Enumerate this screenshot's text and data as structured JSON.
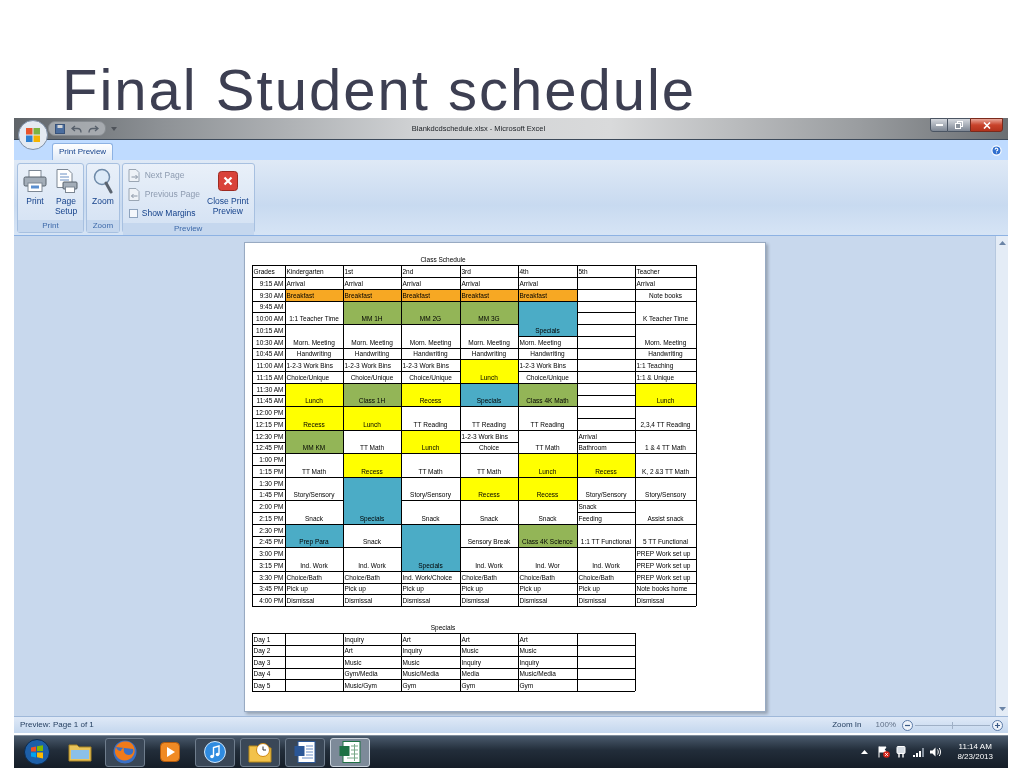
{
  "slide": {
    "title": "Final Student schedule"
  },
  "window": {
    "title": "Blankdcdschedule.xlsx - Microsoft Excel"
  },
  "tabs": [
    {
      "label": "Print Preview",
      "selected": true
    }
  ],
  "ribbon": {
    "groups": [
      {
        "label": "Print",
        "commands": [
          {
            "kind": "large",
            "lines": [
              "Print"
            ],
            "disabled": false
          },
          {
            "kind": "large",
            "lines": [
              "Page",
              "Setup"
            ],
            "disabled": false
          }
        ]
      },
      {
        "label": "Zoom",
        "commands": [
          {
            "kind": "large",
            "lines": [
              "Zoom"
            ],
            "disabled": false
          }
        ]
      },
      {
        "label": "Preview",
        "commands": [
          {
            "kind": "small",
            "lines": [
              "Next Page"
            ],
            "disabled": true
          },
          {
            "kind": "small",
            "lines": [
              "Previous Page"
            ],
            "disabled": true
          },
          {
            "kind": "checkbox",
            "lines": [
              "Show Margins"
            ],
            "checked": false,
            "disabled": false
          },
          {
            "kind": "large",
            "lines": [
              "Close Print",
              "Preview"
            ],
            "disabled": false
          }
        ]
      }
    ]
  },
  "sheet": {
    "schedule": {
      "title": "Class Schedule",
      "columns": [
        "Grades",
        "Kindergarten",
        "1st",
        "2nd",
        "3rd",
        "4th",
        "5th",
        "Teacher"
      ],
      "rows": [
        {
          "cells": [
            {
              "kind": "time",
              "text": "9:15 AM"
            },
            {
              "kind": "left",
              "text": "Arrival"
            },
            {
              "kind": "left",
              "text": "Arrival"
            },
            {
              "kind": "left",
              "text": "Arrival"
            },
            {
              "kind": "left",
              "text": "Arrival"
            },
            {
              "kind": "left",
              "text": "Arrival"
            },
            {
              "kind": "left"
            },
            {
              "kind": "left",
              "text": "Arrival"
            }
          ]
        },
        {
          "cells": [
            {
              "kind": "time",
              "text": "9:30 AM"
            },
            {
              "kind": "left",
              "text": "Breakfast",
              "color": "#f7a823"
            },
            {
              "kind": "left",
              "text": "Breakfast",
              "color": "#f7a823"
            },
            {
              "kind": "left",
              "text": "Breakfast",
              "color": "#f7a823"
            },
            {
              "kind": "left",
              "text": "Breakfast",
              "color": "#f7a823"
            },
            {
              "kind": "left",
              "text": "Breakfast",
              "color": "#f7a823"
            },
            {
              "kind": "left"
            },
            {
              "kind": "centered",
              "text": "Note books"
            }
          ]
        },
        {
          "cells": [
            {
              "kind": "time",
              "text": "9:45 AM"
            },
            {
              "kind": "merged"
            },
            {
              "kind": "merged"
            },
            {
              "kind": "merged"
            },
            {
              "kind": "merged"
            },
            {
              "kind": "merged"
            },
            {
              "kind": "left"
            },
            {
              "kind": "merged"
            }
          ]
        },
        {
          "cells": [
            {
              "kind": "time",
              "text": "10:00 AM"
            },
            {
              "kind": "centered",
              "text": "1:1 Teacher Time"
            },
            {
              "kind": "centered",
              "text": "MM 1H",
              "color": "#93b557"
            },
            {
              "kind": "centered",
              "text": "MM 2G",
              "color": "#93b557"
            },
            {
              "kind": "centered",
              "text": "MM 3G",
              "color": "#93b557"
            },
            {
              "kind": "merged"
            },
            {
              "kind": "left"
            },
            {
              "kind": "centered",
              "text": "K Teacher Time"
            }
          ]
        },
        {
          "cells": [
            {
              "kind": "time",
              "text": "10:15 AM"
            },
            {
              "kind": "merged"
            },
            {
              "kind": "merged"
            },
            {
              "kind": "merged"
            },
            {
              "kind": "merged"
            },
            {
              "kind": "centered",
              "text": "Specials",
              "color": "#4bacc6"
            },
            {
              "kind": "left"
            },
            {
              "kind": "merged"
            }
          ]
        },
        {
          "cells": [
            {
              "kind": "time",
              "text": "10:30 AM"
            },
            {
              "kind": "centered",
              "text": "Morn. Meeting"
            },
            {
              "kind": "centered",
              "text": "Morn. Meeting"
            },
            {
              "kind": "centered",
              "text": "Morn. Meeting"
            },
            {
              "kind": "centered",
              "text": "Morn. Meeting"
            },
            {
              "kind": "left",
              "text": "Morn. Meeting"
            },
            {
              "kind": "left"
            },
            {
              "kind": "centered",
              "text": "Morn. Meeting"
            }
          ]
        },
        {
          "cells": [
            {
              "kind": "time",
              "text": "10:45 AM"
            },
            {
              "kind": "centered",
              "text": "Handwriting"
            },
            {
              "kind": "centered",
              "text": "Handwriting"
            },
            {
              "kind": "centered",
              "text": "Handwriting"
            },
            {
              "kind": "centered",
              "text": "Handwriting"
            },
            {
              "kind": "centered",
              "text": "Handwriting"
            },
            {
              "kind": "left"
            },
            {
              "kind": "centered",
              "text": "Handwriting"
            }
          ]
        },
        {
          "cells": [
            {
              "kind": "time",
              "text": "11:00 AM"
            },
            {
              "kind": "left",
              "text": "1-2-3 Work Bins"
            },
            {
              "kind": "left",
              "text": "1-2-3 Work Bins"
            },
            {
              "kind": "left",
              "text": "1-2-3 Work Bins"
            },
            {
              "kind": "merged"
            },
            {
              "kind": "left",
              "text": "1-2-3 Work Bins"
            },
            {
              "kind": "left"
            },
            {
              "kind": "left",
              "text": "1:1 Teaching"
            }
          ]
        },
        {
          "cells": [
            {
              "kind": "time",
              "text": "11:15 AM"
            },
            {
              "kind": "left",
              "text": "Choice/Unique"
            },
            {
              "kind": "centered",
              "text": "Choice/Unique"
            },
            {
              "kind": "centered",
              "text": "Choice/Unique"
            },
            {
              "kind": "centered",
              "text": "Lunch",
              "color": "#ffff00"
            },
            {
              "kind": "centered",
              "text": "Choice/Unique"
            },
            {
              "kind": "left"
            },
            {
              "kind": "left",
              "text": "1:1 & Unique"
            }
          ]
        },
        {
          "cells": [
            {
              "kind": "time",
              "text": "11:30 AM"
            },
            {
              "kind": "merged"
            },
            {
              "kind": "merged"
            },
            {
              "kind": "merged"
            },
            {
              "kind": "merged"
            },
            {
              "kind": "merged"
            },
            {
              "kind": "left"
            },
            {
              "kind": "merged"
            }
          ]
        },
        {
          "cells": [
            {
              "kind": "time",
              "text": "11:45 AM"
            },
            {
              "kind": "centered",
              "text": "Lunch",
              "color": "#ffff00"
            },
            {
              "kind": "centered",
              "text": "Class 1H",
              "color": "#93b557"
            },
            {
              "kind": "centered",
              "text": "Recess",
              "color": "#ffff00"
            },
            {
              "kind": "centered",
              "text": "Specials",
              "color": "#4bacc6"
            },
            {
              "kind": "centered",
              "text": "Class 4K Math",
              "color": "#93b557"
            },
            {
              "kind": "left"
            },
            {
              "kind": "centered",
              "text": "Lunch",
              "color": "#ffff00"
            }
          ]
        },
        {
          "cells": [
            {
              "kind": "time",
              "text": "12:00 PM"
            },
            {
              "kind": "merged"
            },
            {
              "kind": "merged"
            },
            {
              "kind": "merged"
            },
            {
              "kind": "merged"
            },
            {
              "kind": "merged"
            },
            {
              "kind": "left"
            },
            {
              "kind": "merged"
            }
          ]
        },
        {
          "cells": [
            {
              "kind": "time",
              "text": "12:15 PM"
            },
            {
              "kind": "centered",
              "text": "Recess",
              "color": "#ffff00"
            },
            {
              "kind": "centered",
              "text": "Lunch",
              "color": "#ffff00"
            },
            {
              "kind": "centered",
              "text": "TT Reading"
            },
            {
              "kind": "centered",
              "text": "TT Reading"
            },
            {
              "kind": "centered",
              "text": "TT Reading"
            },
            {
              "kind": "left"
            },
            {
              "kind": "centered",
              "text": "2,3,4 TT Reading"
            }
          ]
        },
        {
          "cells": [
            {
              "kind": "time",
              "text": "12:30 PM"
            },
            {
              "kind": "merged"
            },
            {
              "kind": "merged"
            },
            {
              "kind": "merged"
            },
            {
              "kind": "left",
              "text": "1-2-3 Work Bins"
            },
            {
              "kind": "merged"
            },
            {
              "kind": "left",
              "text": "Arrival"
            },
            {
              "kind": "merged"
            }
          ]
        },
        {
          "cells": [
            {
              "kind": "time",
              "text": "12:45 PM"
            },
            {
              "kind": "centered",
              "text": "MM KM",
              "color": "#93b557"
            },
            {
              "kind": "centered",
              "text": "TT Math"
            },
            {
              "kind": "centered",
              "text": "Lunch",
              "color": "#ffff00"
            },
            {
              "kind": "centered",
              "text": "Choice"
            },
            {
              "kind": "centered",
              "text": "TT Math"
            },
            {
              "kind": "left",
              "text": "Bathroom"
            },
            {
              "kind": "centered",
              "text": "1 & 4 TT Math"
            }
          ]
        },
        {
          "cells": [
            {
              "kind": "time",
              "text": "1:00 PM"
            },
            {
              "kind": "merged"
            },
            {
              "kind": "merged"
            },
            {
              "kind": "merged"
            },
            {
              "kind": "merged"
            },
            {
              "kind": "merged"
            },
            {
              "kind": "merged"
            },
            {
              "kind": "merged"
            }
          ]
        },
        {
          "cells": [
            {
              "kind": "time",
              "text": "1:15 PM"
            },
            {
              "kind": "centered",
              "text": "TT Math"
            },
            {
              "kind": "centered",
              "text": "Recess",
              "color": "#ffff00"
            },
            {
              "kind": "centered",
              "text": "TT Math"
            },
            {
              "kind": "centered",
              "text": "TT Math"
            },
            {
              "kind": "centered",
              "text": "Lunch",
              "color": "#ffff00"
            },
            {
              "kind": "centered",
              "text": "Recess",
              "color": "#ffff00"
            },
            {
              "kind": "centered",
              "text": "K, 2 &3 TT Math"
            }
          ]
        },
        {
          "cells": [
            {
              "kind": "time",
              "text": "1:30 PM"
            },
            {
              "kind": "merged"
            },
            {
              "kind": "merged"
            },
            {
              "kind": "merged"
            },
            {
              "kind": "merged"
            },
            {
              "kind": "merged"
            },
            {
              "kind": "merged"
            },
            {
              "kind": "merged"
            }
          ]
        },
        {
          "cells": [
            {
              "kind": "time",
              "text": "1:45 PM"
            },
            {
              "kind": "centered",
              "text": "Story/Sensory"
            },
            {
              "kind": "merged"
            },
            {
              "kind": "centered",
              "text": "Story/Sensory"
            },
            {
              "kind": "centered",
              "text": "Recess",
              "color": "#ffff00"
            },
            {
              "kind": "centered",
              "text": "Recess",
              "color": "#ffff00"
            },
            {
              "kind": "centered",
              "text": "Story/Sensory"
            },
            {
              "kind": "centered",
              "text": "Story/Sensory"
            }
          ]
        },
        {
          "cells": [
            {
              "kind": "time",
              "text": "2:00 PM"
            },
            {
              "kind": "merged"
            },
            {
              "kind": "merged"
            },
            {
              "kind": "merged"
            },
            {
              "kind": "merged"
            },
            {
              "kind": "merged"
            },
            {
              "kind": "left",
              "text": "Snack"
            },
            {
              "kind": "merged"
            }
          ]
        },
        {
          "cells": [
            {
              "kind": "time",
              "text": "2:15 PM"
            },
            {
              "kind": "centered",
              "text": "Snack"
            },
            {
              "kind": "centered",
              "text": "Specials",
              "color": "#4bacc6"
            },
            {
              "kind": "centered",
              "text": "Snack"
            },
            {
              "kind": "centered",
              "text": "Snack"
            },
            {
              "kind": "centered",
              "text": "Snack"
            },
            {
              "kind": "left",
              "text": "Feeding"
            },
            {
              "kind": "centered",
              "text": "Assist snack"
            }
          ]
        },
        {
          "cells": [
            {
              "kind": "time",
              "text": "2:30 PM"
            },
            {
              "kind": "merged"
            },
            {
              "kind": "merged"
            },
            {
              "kind": "merged"
            },
            {
              "kind": "merged"
            },
            {
              "kind": "merged"
            },
            {
              "kind": "merged"
            },
            {
              "kind": "merged"
            }
          ]
        },
        {
          "cells": [
            {
              "kind": "time",
              "text": "2:45 PM"
            },
            {
              "kind": "centered",
              "text": "Prep Para",
              "color": "#4bacc6"
            },
            {
              "kind": "centered",
              "text": "Snack"
            },
            {
              "kind": "merged"
            },
            {
              "kind": "centered",
              "text": "Sensory Break"
            },
            {
              "kind": "centered",
              "text": "Class 4K Science",
              "color": "#93b557"
            },
            {
              "kind": "centered",
              "text": "1:1 TT Functional"
            },
            {
              "kind": "centered",
              "text": "5 TT Functional"
            }
          ]
        },
        {
          "cells": [
            {
              "kind": "time",
              "text": "3:00 PM"
            },
            {
              "kind": "merged"
            },
            {
              "kind": "merged"
            },
            {
              "kind": "merged"
            },
            {
              "kind": "merged"
            },
            {
              "kind": "merged"
            },
            {
              "kind": "merged"
            },
            {
              "kind": "left",
              "text": "PREP Work set up"
            }
          ]
        },
        {
          "cells": [
            {
              "kind": "time",
              "text": "3:15 PM"
            },
            {
              "kind": "centered",
              "text": "Ind. Work"
            },
            {
              "kind": "centered",
              "text": "Ind. Work"
            },
            {
              "kind": "centered",
              "text": "Specials",
              "color": "#4bacc6"
            },
            {
              "kind": "centered",
              "text": "Ind. Work"
            },
            {
              "kind": "centered",
              "text": "Ind. Wor"
            },
            {
              "kind": "centered",
              "text": "Ind. Work"
            },
            {
              "kind": "left",
              "text": "PREP Work set up"
            }
          ]
        },
        {
          "cells": [
            {
              "kind": "time",
              "text": "3:30 PM"
            },
            {
              "kind": "left",
              "text": "Choice/Bath"
            },
            {
              "kind": "left",
              "text": "Choice/Bath"
            },
            {
              "kind": "left",
              "text": "Ind. Work/Choice"
            },
            {
              "kind": "left",
              "text": "Choice/Bath"
            },
            {
              "kind": "left",
              "text": "Choice/Bath"
            },
            {
              "kind": "left",
              "text": "Choice/Bath"
            },
            {
              "kind": "left",
              "text": "PREP Work set up"
            }
          ]
        },
        {
          "cells": [
            {
              "kind": "time",
              "text": "3:45 PM"
            },
            {
              "kind": "left",
              "text": "Pick up"
            },
            {
              "kind": "left",
              "text": "Pick up"
            },
            {
              "kind": "left",
              "text": "Pick up"
            },
            {
              "kind": "left",
              "text": "Pick up"
            },
            {
              "kind": "left",
              "text": "Pick up"
            },
            {
              "kind": "left",
              "text": "Pick up"
            },
            {
              "kind": "left",
              "text": "Note books home"
            }
          ]
        },
        {
          "cells": [
            {
              "kind": "time",
              "text": "4:00 PM"
            },
            {
              "kind": "left",
              "text": "Dismissal"
            },
            {
              "kind": "left",
              "text": "Dismissal"
            },
            {
              "kind": "left",
              "text": "Dismissal"
            },
            {
              "kind": "left",
              "text": "Dismissal"
            },
            {
              "kind": "left",
              "text": "Dismissal"
            },
            {
              "kind": "left",
              "text": "Dismissal"
            },
            {
              "kind": "left",
              "text": "Dismissal"
            }
          ]
        }
      ]
    },
    "specials": {
      "title": "Specials",
      "rows": [
        {
          "day": "Day 1",
          "cells": [
            "Inquiry",
            "Art",
            "Art",
            "Art"
          ]
        },
        {
          "day": "Day 2",
          "cells": [
            "Art",
            "Inquiry",
            "Music",
            "Music"
          ]
        },
        {
          "day": "Day 3",
          "cells": [
            "Music",
            "Music",
            "Inquiry",
            "Inquiry"
          ]
        },
        {
          "day": "Day 4",
          "cells": [
            "Gym/Media",
            "Music/Media",
            "Media",
            "Music/Media"
          ]
        },
        {
          "day": "Day 5",
          "cells": [
            "Music/Gym",
            "Gym",
            "Gym",
            "Gym"
          ]
        }
      ]
    }
  },
  "status_bar": {
    "text": "Preview: Page 1 of 1",
    "zoom_label": "Zoom In",
    "zoom_value": "100%",
    "zoom_disabled": true
  },
  "taskbar": {
    "apps": [
      {
        "running": false,
        "selected": false
      },
      {
        "running": true,
        "selected": false
      },
      {
        "running": false,
        "selected": false
      },
      {
        "running": true,
        "selected": false
      },
      {
        "running": true,
        "selected": false
      },
      {
        "running": true,
        "selected": false
      },
      {
        "running": true,
        "selected": true
      }
    ],
    "clock": {
      "time": "11:14 AM",
      "date": "8/23/2013"
    }
  }
}
